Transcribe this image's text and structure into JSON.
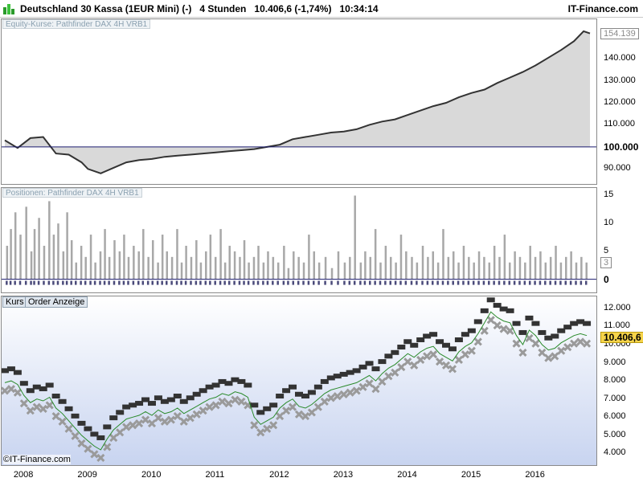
{
  "window": {
    "instrument": "Deutschland 30 Kassa (1EUR Mini) (-)",
    "timeframe": "4 Stunden",
    "last_change": "10.406,6 (-1,74%)",
    "time": "10:34:14",
    "brand": "IT-Finance.com"
  },
  "colors": {
    "equity_fill": "#d9d9d9",
    "equity_line": "#333333",
    "baseline": "#1a1a6e",
    "position_bar": "#a8a8a8",
    "position_marker": "#4a4a7a",
    "price_bg_top": "#ffffff",
    "price_bg_bottom": "#c8d4f0",
    "price_flag": "#f6d44a"
  },
  "watermark": "©IT-Finance.com",
  "chart_data": [
    {
      "type": "area",
      "title": "Equity-Kurse: Pathfinder DAX 4H VRB1",
      "x_label_years": [
        "2008",
        "2009",
        "2010",
        "2011",
        "2012",
        "2013",
        "2014",
        "2015",
        "2016"
      ],
      "x": [
        2007.7,
        2007.9,
        2008.1,
        2008.3,
        2008.5,
        2008.7,
        2008.9,
        2009.0,
        2009.2,
        2009.4,
        2009.6,
        2009.8,
        2010.0,
        2010.2,
        2010.4,
        2010.6,
        2010.8,
        2011.0,
        2011.2,
        2011.4,
        2011.6,
        2011.8,
        2012.0,
        2012.2,
        2012.4,
        2012.6,
        2012.8,
        2013.0,
        2013.2,
        2013.4,
        2013.6,
        2013.8,
        2014.0,
        2014.2,
        2014.4,
        2014.6,
        2014.8,
        2015.0,
        2015.2,
        2015.4,
        2015.6,
        2015.8,
        2016.0,
        2016.2,
        2016.4,
        2016.6,
        2016.75,
        2016.85
      ],
      "y": [
        103000,
        99500,
        104000,
        104500,
        97000,
        96500,
        93000,
        90000,
        88000,
        90500,
        93000,
        94000,
        94500,
        95500,
        96000,
        96500,
        97000,
        97500,
        98000,
        98500,
        99000,
        100000,
        101000,
        103500,
        104500,
        105500,
        106500,
        107000,
        108000,
        110000,
        111500,
        112500,
        114500,
        116500,
        118500,
        120000,
        122500,
        124500,
        126000,
        129000,
        131500,
        134000,
        137000,
        140500,
        144000,
        148000,
        152500,
        151500
      ],
      "y_ticks": [
        "90.000",
        "100.000",
        "110.000",
        "120.000",
        "130.000",
        "140.000",
        "150.000"
      ],
      "ylim": [
        85000,
        155000
      ],
      "baseline": 100000,
      "baseline_label": "100.000",
      "last_value_label": "154.139"
    },
    {
      "type": "bar",
      "title": "Positionen: Pathfinder DAX 4H VRB1",
      "y_ticks": [
        "0",
        "5",
        "10",
        "15"
      ],
      "ylim": [
        -1.5,
        15.5
      ],
      "last_value_label": "3",
      "x": [
        2007.72,
        2007.78,
        2007.85,
        2007.93,
        2008.02,
        2008.1,
        2008.15,
        2008.22,
        2008.3,
        2008.38,
        2008.45,
        2008.52,
        2008.6,
        2008.66,
        2008.73,
        2008.8,
        2008.88,
        2008.95,
        2009.03,
        2009.1,
        2009.18,
        2009.25,
        2009.32,
        2009.4,
        2009.48,
        2009.55,
        2009.62,
        2009.7,
        2009.78,
        2009.85,
        2009.93,
        2010.0,
        2010.08,
        2010.15,
        2010.22,
        2010.3,
        2010.38,
        2010.45,
        2010.52,
        2010.6,
        2010.68,
        2010.75,
        2010.83,
        2010.9,
        2010.98,
        2011.06,
        2011.13,
        2011.2,
        2011.28,
        2011.36,
        2011.43,
        2011.5,
        2011.58,
        2011.65,
        2011.73,
        2011.8,
        2011.88,
        2011.96,
        2012.05,
        2012.12,
        2012.2,
        2012.28,
        2012.36,
        2012.44,
        2012.52,
        2012.6,
        2012.7,
        2012.8,
        2012.9,
        2013.0,
        2013.08,
        2013.16,
        2013.25,
        2013.32,
        2013.4,
        2013.48,
        2013.56,
        2013.64,
        2013.72,
        2013.8,
        2013.88,
        2013.96,
        2014.05,
        2014.13,
        2014.22,
        2014.3,
        2014.38,
        2014.46,
        2014.54,
        2014.62,
        2014.7,
        2014.78,
        2014.86,
        2014.94,
        2015.02,
        2015.1,
        2015.18,
        2015.26,
        2015.34,
        2015.42,
        2015.5,
        2015.58,
        2015.66,
        2015.74,
        2015.82,
        2015.9,
        2015.98,
        2016.06,
        2016.14,
        2016.22,
        2016.3,
        2016.38,
        2016.46,
        2016.54,
        2016.62,
        2016.7,
        2016.78
      ],
      "values": [
        6,
        9,
        12,
        8,
        13,
        5,
        9,
        11,
        6,
        14,
        8,
        10,
        5,
        12,
        7,
        3,
        6,
        4,
        8,
        3,
        5,
        9,
        4,
        7,
        5,
        8,
        4,
        6,
        5,
        9,
        4,
        7,
        3,
        8,
        5,
        4,
        9,
        3,
        6,
        4,
        7,
        3,
        5,
        8,
        4,
        9,
        3,
        6,
        5,
        4,
        7,
        3,
        4,
        6,
        3,
        5,
        4,
        3,
        6,
        2,
        5,
        4,
        3,
        8,
        5,
        3,
        4,
        2,
        5,
        3,
        4,
        15,
        3,
        5,
        4,
        9,
        3,
        6,
        4,
        3,
        8,
        5,
        4,
        3,
        6,
        4,
        5,
        3,
        9,
        4,
        5,
        3,
        6,
        4,
        3,
        5,
        4,
        3,
        6,
        4,
        8,
        3,
        5,
        4,
        3,
        6,
        4,
        5,
        3,
        4,
        6,
        3,
        4,
        5,
        3,
        4,
        3
      ],
      "baseline": 0
    },
    {
      "type": "scatter",
      "title": "Kurs",
      "tab": "Order Anzeige",
      "y_ticks": [
        "4.000",
        "5.000",
        "6.000",
        "7.000",
        "8.000",
        "9.000",
        "10.000",
        "11.000",
        "12.000"
      ],
      "ylim": [
        3800,
        12300
      ],
      "last_value_label": "10.406,6",
      "series": [
        {
          "x": [
            2007.7,
            2007.8,
            2007.9,
            2008.0,
            2008.1,
            2008.2,
            2008.3,
            2008.4,
            2008.5,
            2008.6,
            2008.7,
            2008.8,
            2008.9,
            2009.0,
            2009.1,
            2009.2,
            2009.3,
            2009.4,
            2009.5,
            2009.6,
            2009.7,
            2009.8,
            2009.9,
            2010.0,
            2010.1,
            2010.2,
            2010.3,
            2010.4,
            2010.5,
            2010.6,
            2010.7,
            2010.8,
            2010.9,
            2011.0,
            2011.1,
            2011.2,
            2011.3,
            2011.4,
            2011.5,
            2011.6,
            2011.7,
            2011.8,
            2011.9,
            2012.0,
            2012.1,
            2012.2,
            2012.3,
            2012.4,
            2012.5,
            2012.6,
            2012.7,
            2012.8,
            2012.9,
            2013.0,
            2013.1,
            2013.2,
            2013.3,
            2013.4,
            2013.5,
            2013.6,
            2013.7,
            2013.8,
            2013.9,
            2014.0,
            2014.1,
            2014.2,
            2014.3,
            2014.4,
            2014.5,
            2014.6,
            2014.7,
            2014.8,
            2014.9,
            2015.0,
            2015.1,
            2015.2,
            2015.3,
            2015.4,
            2015.5,
            2015.6,
            2015.7,
            2015.8,
            2015.9,
            2016.0,
            2016.1,
            2016.2,
            2016.3,
            2016.4,
            2016.5,
            2016.6,
            2016.7,
            2016.8
          ],
          "values": [
            7900,
            8000,
            7800,
            7200,
            6800,
            7000,
            6900,
            7100,
            6500,
            6200,
            5800,
            5400,
            5000,
            4700,
            4400,
            4200,
            4800,
            5300,
            5600,
            5900,
            6000,
            6100,
            6300,
            6100,
            6400,
            6200,
            6300,
            6500,
            6200,
            6400,
            6600,
            6800,
            7000,
            7100,
            7300,
            7200,
            7400,
            7300,
            7100,
            6000,
            5600,
            5800,
            6000,
            6500,
            6800,
            7000,
            6600,
            6500,
            6700,
            7000,
            7300,
            7500,
            7600,
            7700,
            7800,
            7900,
            8100,
            8300,
            8000,
            8400,
            8700,
            8900,
            9200,
            9500,
            9300,
            9600,
            9800,
            9900,
            9500,
            9300,
            9100,
            9600,
            9900,
            10100,
            10600,
            11200,
            11800,
            11500,
            11300,
            11200,
            10500,
            10000,
            10800,
            10500,
            10000,
            9700,
            9800,
            10100,
            10300,
            10500,
            10600,
            10500
          ],
          "name": "Kurs"
        }
      ]
    }
  ]
}
